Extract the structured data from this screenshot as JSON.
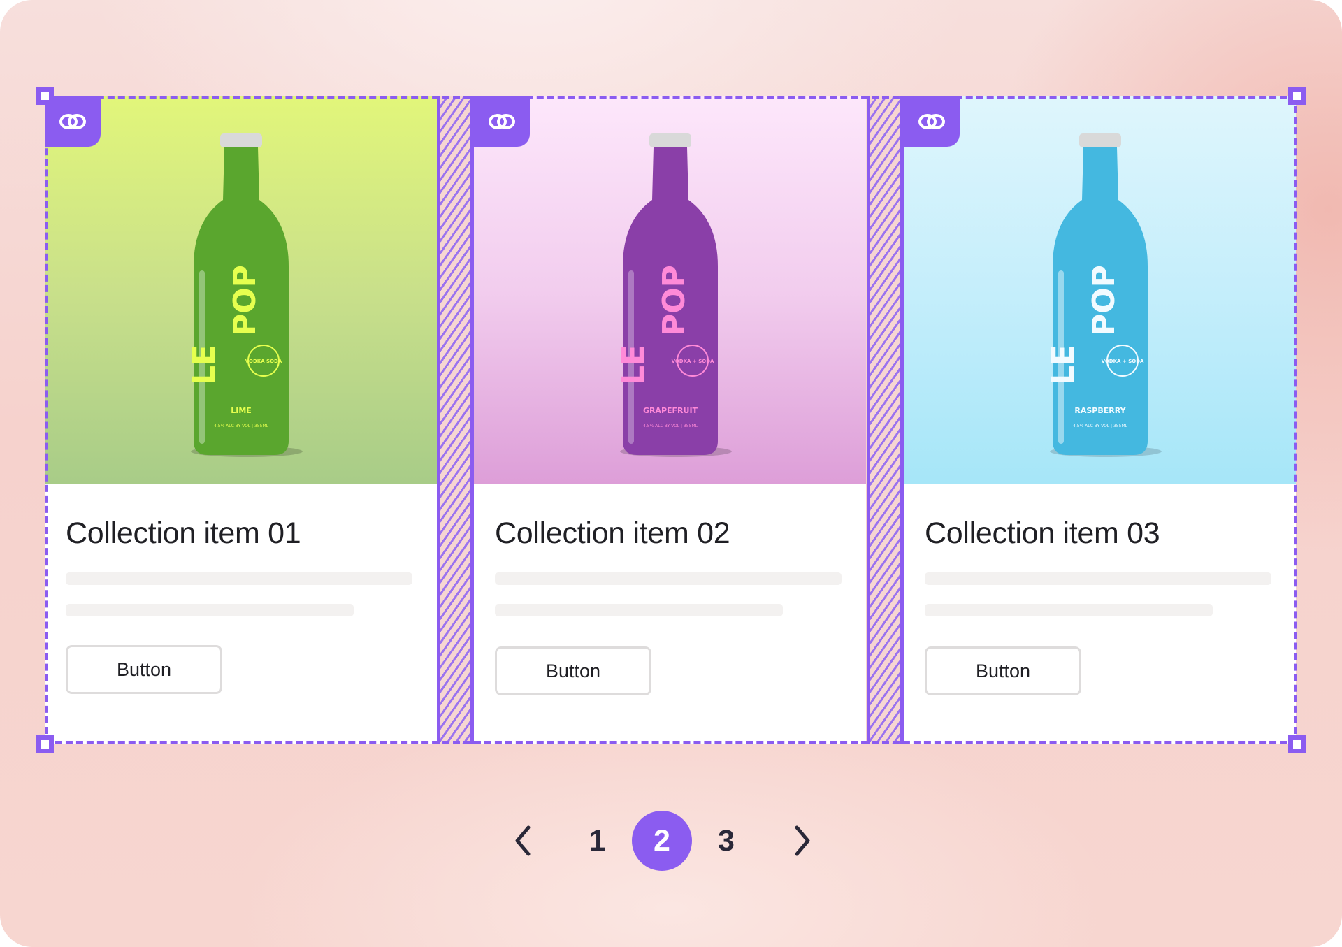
{
  "colors": {
    "accent": "#8b5cf0",
    "text": "#1f1f24",
    "placeholder_bar": "#f3f1f0",
    "button_border": "#dedcdc"
  },
  "cards": [
    {
      "title": "Collection item 01",
      "button_label": "Button",
      "product": {
        "brand_top": "LE",
        "brand_bottom": "POP",
        "badge": "VODKA SODA",
        "flavor": "LIME",
        "fine_print": "4.5% ALC BY VOL | 355ML"
      },
      "bottle_color": "#5aa62e",
      "label_color": "#e6ff4f",
      "icon": "link-icon"
    },
    {
      "title": "Collection item 02",
      "button_label": "Button",
      "product": {
        "brand_top": "LE",
        "brand_bottom": "POP",
        "badge": "VODKA + SODA",
        "flavor": "GRAPEFRUIT",
        "fine_print": "4.5% ALC BY VOL | 355ML"
      },
      "bottle_color": "#8a3fa8",
      "label_color": "#ff8ad8",
      "icon": "link-icon"
    },
    {
      "title": "Collection item 03",
      "button_label": "Button",
      "product": {
        "brand_top": "LE",
        "brand_bottom": "POP",
        "badge": "VODKA + SODA",
        "flavor": "RASPBERRY",
        "fine_print": "4.5% ALC BY VOL | 355ML"
      },
      "bottle_color": "#44b8e0",
      "label_color": "#f2fbff",
      "icon": "link-icon"
    }
  ],
  "pagination": {
    "prev_icon": "chevron-left-icon",
    "next_icon": "chevron-right-icon",
    "pages": [
      "1",
      "2",
      "3"
    ],
    "current": "2"
  }
}
